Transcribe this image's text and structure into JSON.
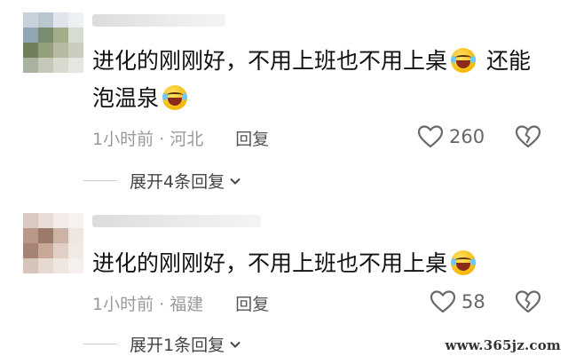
{
  "comments": [
    {
      "text_part1": "进化的刚刚好，不用上班也不用上桌",
      "text_part2": "还能",
      "text_part3": "泡温泉",
      "time_location": "1小时前 · 河北",
      "reply_label": "回复",
      "like_count": "260",
      "expand_label": "展开4条回复"
    },
    {
      "text_part1": "进化的刚刚好，不用上班也不用上桌",
      "time_location": "1小时前 · 福建",
      "reply_label": "回复",
      "like_count": "58",
      "expand_label": "展开1条回复"
    }
  ],
  "watermark": "www.365jz.com",
  "icons": {
    "emoji": "laughing-crying-emoji",
    "like": "heart-outline-icon",
    "dislike": "broken-heart-icon",
    "expand": "chevron-down-icon"
  }
}
